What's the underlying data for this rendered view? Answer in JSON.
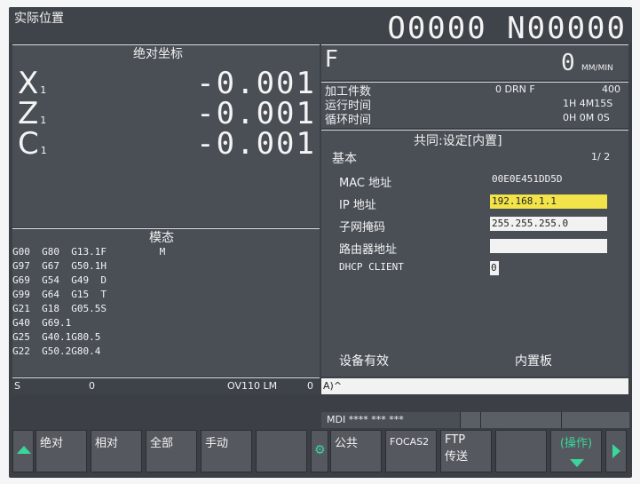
{
  "header": {
    "title": "实际位置",
    "program": "O0000 N00000"
  },
  "abs": {
    "section_title": "绝对坐标",
    "axes": [
      {
        "name": "X",
        "sub": "1",
        "value": "-0.001"
      },
      {
        "name": "Z",
        "sub": "1",
        "value": "-0.001"
      },
      {
        "name": "C",
        "sub": "1",
        "value": "-0.001"
      }
    ]
  },
  "feed": {
    "label": "F",
    "value": "0",
    "unit": "MM/MIN"
  },
  "info": [
    {
      "label": "加工件数",
      "right": "0 DRN F",
      "right2": "400"
    },
    {
      "label": "运行时间",
      "right": "",
      "right2": "1H 4M15S"
    },
    {
      "label": "循环时间",
      "right": "",
      "right2": "0H 0M 0S"
    }
  ],
  "modal": {
    "section_title": "模态",
    "lines": [
      "G00  G80  G13.1F         M",
      "G97  G67  G50.1H",
      "G69  G54  G49  D",
      "G99  G64  G15  T",
      "G21  G18  G05.5S",
      "G40  G69.1",
      "G25  G40.1G80.5",
      "G22  G50.2G80.4"
    ]
  },
  "status": {
    "s": "S",
    "s_val": "0",
    "ov": "OV110 LM",
    "lm": "0"
  },
  "settings": {
    "section_title": "共同:设定[内置]",
    "group": "基本",
    "page": "1/ 2",
    "rows": [
      {
        "label": "MAC 地址",
        "value": "00E0E451DD5D"
      },
      {
        "label": "IP 地址",
        "value": "192.168.1.1"
      },
      {
        "label": "子网掩码",
        "value": "255.255.255.0"
      },
      {
        "label": "路由器地址",
        "value": ""
      },
      {
        "label": "DHCP CLIENT",
        "value": "0"
      }
    ],
    "device_label": "设备有效",
    "device_value": "内置板"
  },
  "input": {
    "prompt": "A)^"
  },
  "mode": {
    "text": "MDI **** *** ***"
  },
  "softkeys": {
    "abs": "绝对",
    "rel": "相对",
    "all": "全部",
    "manual": "手动",
    "common": "公共",
    "focas": "FOCAS2",
    "ftp1": "FTP",
    "ftp2": "传送",
    "op": "(操作)"
  },
  "colors": {
    "ip_highlight": "#f2e34a",
    "screen_bg": "#3c4046"
  }
}
